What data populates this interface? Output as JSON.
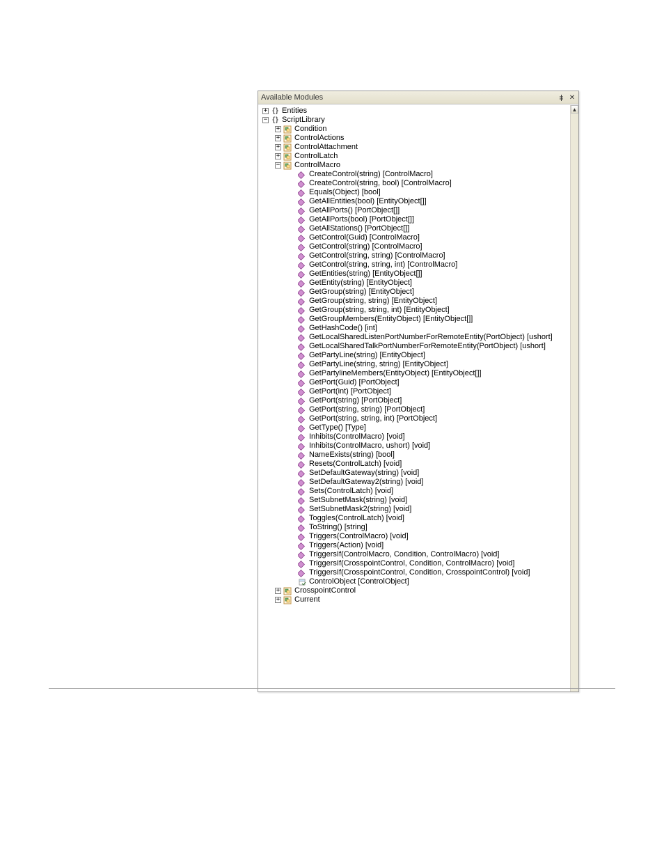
{
  "panel": {
    "title": "Available Modules"
  },
  "tree": {
    "entities": {
      "label": "Entities"
    },
    "scriptlib": {
      "label": "ScriptLibrary"
    },
    "condition": {
      "label": "Condition"
    },
    "controlactions": {
      "label": "ControlActions"
    },
    "controlattachment": {
      "label": "ControlAttachment"
    },
    "controllatch": {
      "label": "ControlLatch"
    },
    "controlmacro": {
      "label": "ControlMacro"
    },
    "crosspointcontrol": {
      "label": "CrosspointControl"
    },
    "current": {
      "label": "Current"
    }
  },
  "methods": [
    "CreateControl(string) [ControlMacro]",
    "CreateControl(string, bool) [ControlMacro]",
    "Equals(Object) [bool]",
    "GetAllEntities(bool) [EntityObject[]]",
    "GetAllPorts() [PortObject[]]",
    "GetAllPorts(bool) [PortObject[]]",
    "GetAllStations() [PortObject[]]",
    "GetControl(Guid) [ControlMacro]",
    "GetControl(string) [ControlMacro]",
    "GetControl(string, string) [ControlMacro]",
    "GetControl(string, string, int) [ControlMacro]",
    "GetEntities(string) [EntityObject[]]",
    "GetEntity(string) [EntityObject]",
    "GetGroup(string) [EntityObject]",
    "GetGroup(string, string) [EntityObject]",
    "GetGroup(string, string, int) [EntityObject]",
    "GetGroupMembers(EntityObject) [EntityObject[]]",
    "GetHashCode() [int]",
    "GetLocalSharedListenPortNumberForRemoteEntity(PortObject) [ushort]",
    "GetLocalSharedTalkPortNumberForRemoteEntity(PortObject) [ushort]",
    "GetPartyLine(string) [EntityObject]",
    "GetPartyLine(string, string) [EntityObject]",
    "GetPartylineMembers(EntityObject) [EntityObject[]]",
    "GetPort(Guid) [PortObject]",
    "GetPort(int) [PortObject]",
    "GetPort(string) [PortObject]",
    "GetPort(string, string) [PortObject]",
    "GetPort(string, string, int) [PortObject]",
    "GetType() [Type]",
    "Inhibits(ControlMacro) [void]",
    "Inhibits(ControlMacro, ushort) [void]",
    "NameExists(string) [bool]",
    "Resets(ControlLatch) [void]",
    "SetDefaultGateway(string) [void]",
    "SetDefaultGateway2(string) [void]",
    "Sets(ControlLatch) [void]",
    "SetSubnetMask(string) [void]",
    "SetSubnetMask2(string) [void]",
    "Toggles(ControlLatch) [void]",
    "ToString() [string]",
    "Triggers(ControlMacro) [void]",
    "Triggers(Action) [void]",
    "TriggersIf(ControlMacro, Condition, ControlMacro) [void]",
    "TriggersIf(CrosspointControl, Condition, ControlMacro) [void]",
    "TriggersIf(CrosspointControl, Condition, CrosspointControl) [void]"
  ],
  "property": "ControlObject [ControlObject]"
}
